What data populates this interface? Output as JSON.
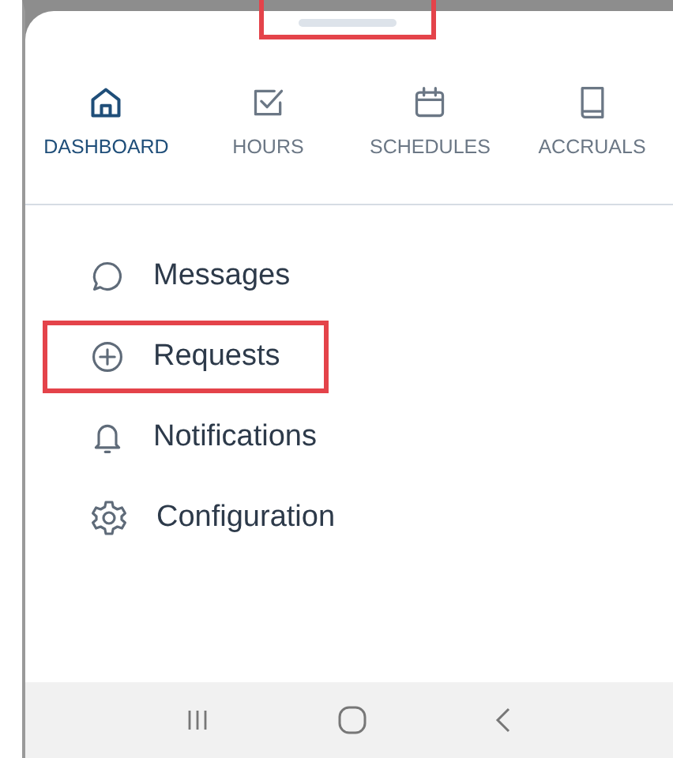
{
  "sheet": {
    "handle": {
      "highlighted": true
    }
  },
  "tabs": [
    {
      "label": "DASHBOARD",
      "kind": "home",
      "selected": true
    },
    {
      "label": "HOURS",
      "kind": "check",
      "selected": false
    },
    {
      "label": "SCHEDULES",
      "kind": "calendar",
      "selected": false
    },
    {
      "label": "ACCRUALS",
      "kind": "book",
      "selected": false
    }
  ],
  "menu": [
    {
      "label": "Messages",
      "kind": "chat",
      "highlighted": false
    },
    {
      "label": "Requests",
      "kind": "plus",
      "highlighted": true
    },
    {
      "label": "Notifications",
      "kind": "bell",
      "highlighted": false
    },
    {
      "label": "Configuration",
      "kind": "gear",
      "highlighted": false
    }
  ],
  "nav_bar": {
    "buttons": [
      {
        "kind": "recents"
      },
      {
        "kind": "home"
      },
      {
        "kind": "back"
      }
    ]
  }
}
